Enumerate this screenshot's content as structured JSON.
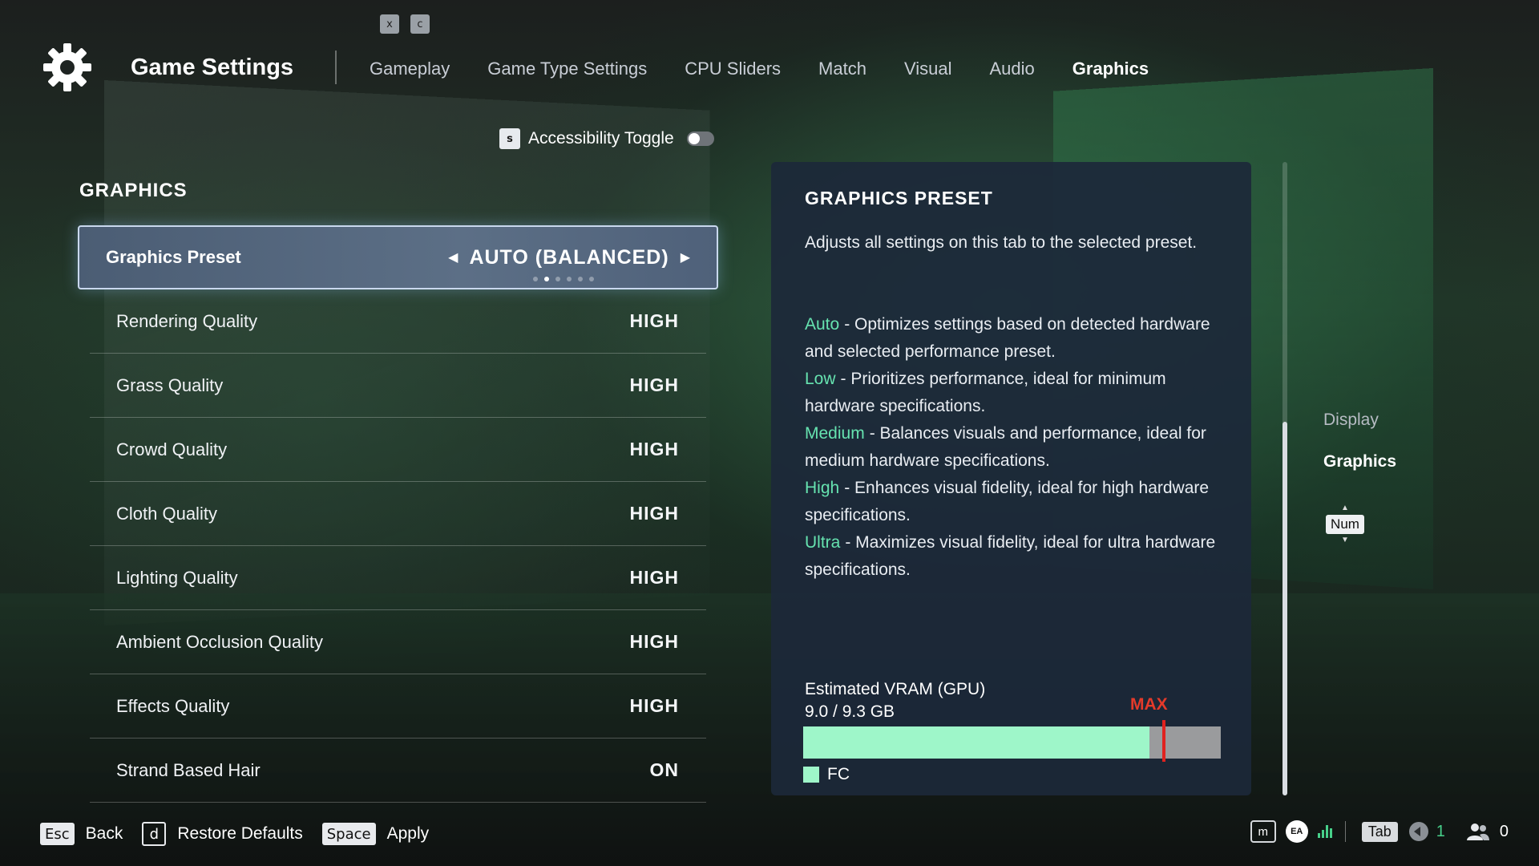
{
  "top_keys": [
    "x",
    "c"
  ],
  "header": {
    "title": "Game Settings",
    "tabs": [
      {
        "label": "Gameplay",
        "active": false
      },
      {
        "label": "Game Type Settings",
        "active": false
      },
      {
        "label": "CPU Sliders",
        "active": false
      },
      {
        "label": "Match",
        "active": false
      },
      {
        "label": "Visual",
        "active": false
      },
      {
        "label": "Audio",
        "active": false
      },
      {
        "label": "Graphics",
        "active": true
      }
    ]
  },
  "accessibility": {
    "key": "s",
    "label": "Accessibility Toggle",
    "on": false
  },
  "section_title": "GRAPHICS",
  "settings": {
    "preset": {
      "label": "Graphics Preset",
      "value": "AUTO (BALANCED)",
      "option_count": 6,
      "option_index": 1
    },
    "rows": [
      {
        "label": "Rendering Quality",
        "value": "HIGH"
      },
      {
        "label": "Grass Quality",
        "value": "HIGH"
      },
      {
        "label": "Crowd Quality",
        "value": "HIGH"
      },
      {
        "label": "Cloth Quality",
        "value": "HIGH"
      },
      {
        "label": "Lighting Quality",
        "value": "HIGH"
      },
      {
        "label": "Ambient Occlusion Quality",
        "value": "HIGH"
      },
      {
        "label": "Effects Quality",
        "value": "HIGH"
      },
      {
        "label": "Strand Based Hair",
        "value": "ON"
      }
    ]
  },
  "info": {
    "title": "GRAPHICS PRESET",
    "description": "Adjusts all settings on this tab to the selected preset.",
    "options": [
      {
        "name": "Auto",
        "text": "- Optimizes settings based on detected hardware and selected performance preset."
      },
      {
        "name": "Low",
        "text": "- Prioritizes performance, ideal for minimum hardware specifications."
      },
      {
        "name": "Medium",
        "text": "- Balances visuals and performance, ideal for medium hardware specifications."
      },
      {
        "name": "High",
        "text": "- Enhances visual fidelity, ideal for high hardware specifications."
      },
      {
        "name": "Ultra",
        "text": "- Maximizes visual fidelity, ideal for ultra hardware specifications."
      }
    ],
    "vram": {
      "label": "Estimated VRAM (GPU)",
      "value_text": "9.0 / 9.3 GB",
      "max_label": "MAX",
      "used_fraction": 0.83,
      "max_fraction": 0.86,
      "legend": "FC",
      "colors": {
        "fill": "#9ef6c9",
        "remaining": "#9a9b9d",
        "max": "#e0221f"
      }
    }
  },
  "scroll": {
    "thumb_start": 0.41,
    "thumb_end": 1.0
  },
  "side_nav": {
    "items": [
      {
        "label": "Display",
        "active": false
      },
      {
        "label": "Graphics",
        "active": true
      }
    ],
    "num_key": "Num"
  },
  "footer": {
    "actions": [
      {
        "key": "Esc",
        "label": "Back"
      },
      {
        "key": "d",
        "label": "Restore Defaults"
      },
      {
        "key": "Space",
        "label": "Apply"
      }
    ]
  },
  "status": {
    "m_key": "m",
    "ea_label": "EA",
    "tab_key": "Tab",
    "voice_count": "1",
    "friends_count": "0"
  },
  "colors": {
    "accent_green": "#66e3b0",
    "max_red": "#e53a2a"
  }
}
